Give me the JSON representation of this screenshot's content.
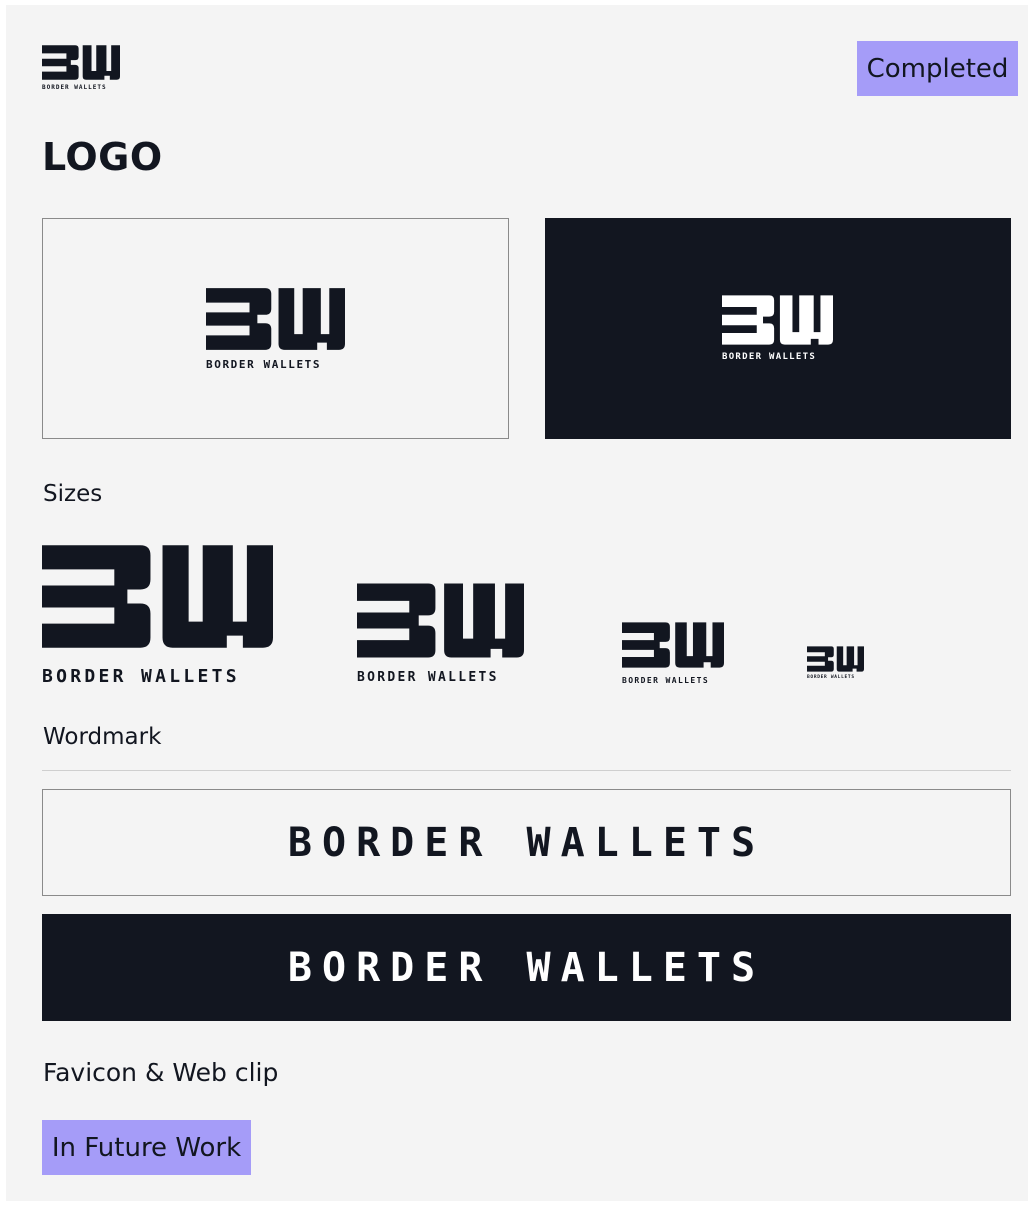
{
  "brand": {
    "monogram": "BW",
    "name": "BORDER WALLETS"
  },
  "header": {
    "status_badge": "Completed"
  },
  "section": {
    "title": "LOGO"
  },
  "sizes": {
    "label": "Sizes"
  },
  "wordmark": {
    "label": "Wordmark",
    "text": "BORDER WALLETS"
  },
  "favicon": {
    "label": "Favicon & Web clip",
    "status_badge": "In Future Work"
  },
  "colors": {
    "ink": "#121620",
    "background": "#f4f4f4",
    "badge": "#a59cf8",
    "white": "#ffffff"
  }
}
